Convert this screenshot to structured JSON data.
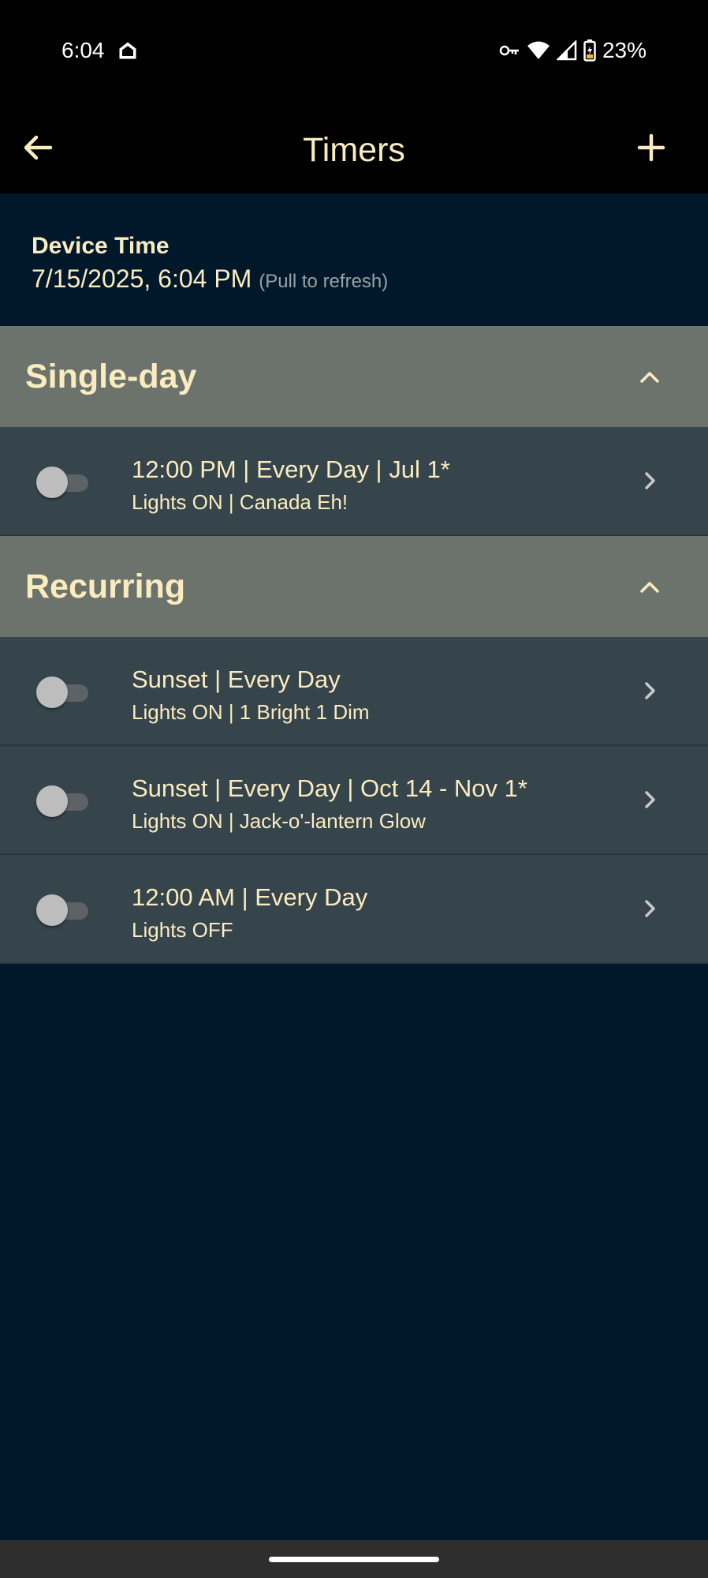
{
  "status_bar": {
    "time": "6:04",
    "battery_percent": "23%",
    "icons": [
      "home-icon",
      "vpn-key-icon",
      "wifi-icon",
      "signal-icon",
      "battery-icon"
    ]
  },
  "app_bar": {
    "title": "Timers",
    "back_icon": "arrow-left-icon",
    "add_icon": "plus-icon"
  },
  "device_time": {
    "label": "Device Time",
    "value": "7/15/2025, 6:04 PM",
    "hint": "(Pull to refresh)"
  },
  "sections": [
    {
      "title": "Single-day",
      "expanded": true,
      "timers": [
        {
          "title": "12:00 PM | Every Day | Jul 1*",
          "subtitle": "Lights ON | Canada Eh!",
          "enabled": false
        }
      ]
    },
    {
      "title": "Recurring",
      "expanded": true,
      "timers": [
        {
          "title": "Sunset | Every Day",
          "subtitle": "Lights ON | 1 Bright 1 Dim",
          "enabled": false
        },
        {
          "title": "Sunset | Every Day | Oct 14 - Nov 1*",
          "subtitle": "Lights ON | Jack-o'-lantern Glow",
          "enabled": false
        },
        {
          "title": "12:00 AM | Every Day",
          "subtitle": "Lights OFF",
          "enabled": false
        }
      ]
    }
  ],
  "colors": {
    "background": "#01182b",
    "app_bar": "#000000",
    "section_header": "#6b736c",
    "row": "#36444b",
    "accent_text": "#fbecbf"
  }
}
